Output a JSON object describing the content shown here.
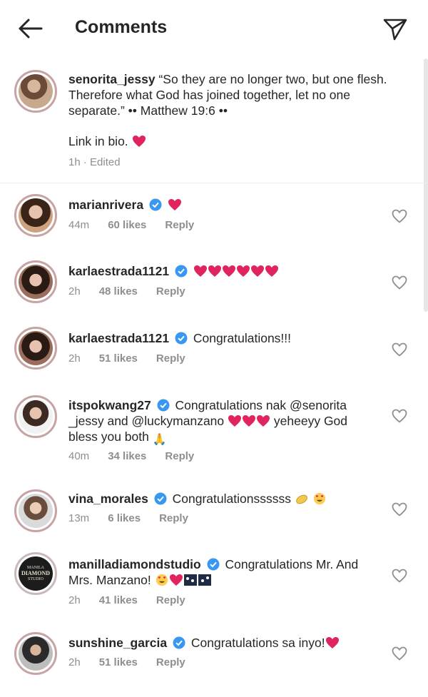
{
  "header": {
    "title": "Comments"
  },
  "caption": {
    "username": "senorita_jessy",
    "text": "“So they are no longer two, but one flesh. Therefore what God has joined together, let no one separate.” •• Matthew 19:6 ••",
    "link": "Link in bio.",
    "time": "1h",
    "edited": "· Edited"
  },
  "comments": [
    {
      "username": "marianrivera",
      "text": "",
      "time": "44m",
      "likes": "60 likes",
      "reply": "Reply"
    },
    {
      "username": "karlaestrada1121",
      "text": "",
      "time": "2h",
      "likes": "48 likes",
      "reply": "Reply"
    },
    {
      "username": "karlaestrada1121",
      "text": "Congratulations!!!",
      "time": "2h",
      "likes": "51 likes",
      "reply": "Reply"
    },
    {
      "username": "itspokwang27",
      "text_a": "Congratulations nak @senorita _jessy and @luckymanzano",
      "text_b": "yeheeyy God bless you both",
      "time": "40m",
      "likes": "34 likes",
      "reply": "Reply"
    },
    {
      "username": "vina_morales",
      "text": "Congratulationssssss",
      "time": "13m",
      "likes": "6 likes",
      "reply": "Reply"
    },
    {
      "username": "manilladiamondstudio",
      "text": "Congratulations Mr. And Mrs. Manzano!",
      "time": "2h",
      "likes": "41 likes",
      "reply": "Reply"
    },
    {
      "username": "sunshine_garcia",
      "text": "Congratulations sa inyo!",
      "time": "2h",
      "likes": "51 likes",
      "reply": "Reply"
    }
  ],
  "brand_logo": {
    "line1": "MANILA",
    "line2": "DIAMOND",
    "line3": "STUDIO"
  },
  "colors": {
    "heart": "#e0245e",
    "verified": "#3897f0",
    "meta": "#8e8e8e"
  }
}
